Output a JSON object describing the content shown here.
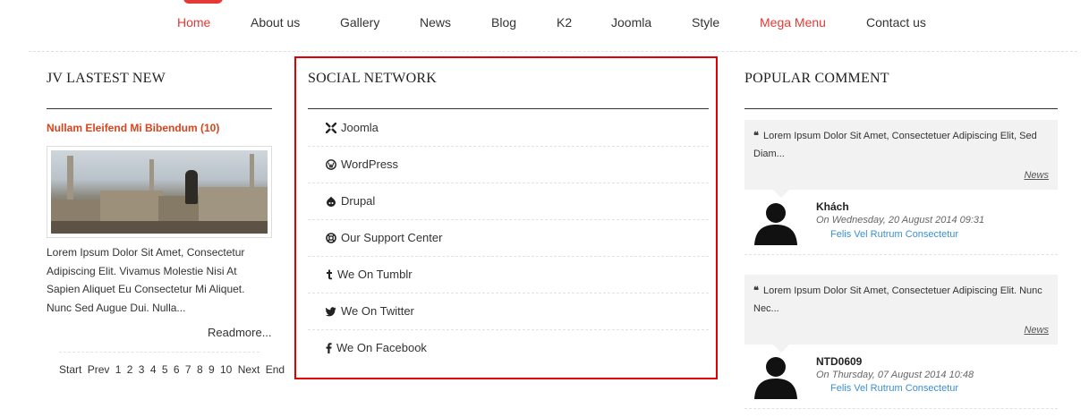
{
  "nav": {
    "items": [
      {
        "label": "Home",
        "active": true
      },
      {
        "label": "About us",
        "active": false
      },
      {
        "label": "Gallery",
        "active": false
      },
      {
        "label": "News",
        "active": false
      },
      {
        "label": "Blog",
        "active": false
      },
      {
        "label": "K2",
        "active": false
      },
      {
        "label": "Joomla",
        "active": false
      },
      {
        "label": "Style",
        "active": false
      },
      {
        "label": "Mega Menu",
        "active": true
      },
      {
        "label": "Contact us",
        "active": false
      }
    ],
    "accent_color": "#e53935"
  },
  "latest": {
    "heading": "JV LASTEST NEW",
    "article_title": "Nullam Eleifend Mi Bibendum (10)",
    "body": "Lorem Ipsum Dolor Sit Amet, Consectetur Adipiscing Elit. Vivamus Molestie Nisi At Sapien Aliquet Eu Consectetur Mi Aliquet. Nunc Sed Augue Dui. Nulla...",
    "readmore": "Readmore...",
    "pager": [
      "Start",
      "Prev",
      "1",
      "2",
      "3",
      "4",
      "5",
      "6",
      "7",
      "8",
      "9",
      "10",
      "Next",
      "End"
    ]
  },
  "social": {
    "heading": "SOCIAL NETWORK",
    "items": [
      {
        "label": "Joomla",
        "icon": "joomla-icon"
      },
      {
        "label": "WordPress",
        "icon": "wordpress-icon"
      },
      {
        "label": "Drupal",
        "icon": "drupal-icon"
      },
      {
        "label": "Our Support Center",
        "icon": "support-icon"
      },
      {
        "label": "We On Tumblr",
        "icon": "tumblr-icon"
      },
      {
        "label": "We On Twitter",
        "icon": "twitter-icon"
      },
      {
        "label": "We On Facebook",
        "icon": "facebook-icon"
      }
    ],
    "highlight_color": "#e00000"
  },
  "popular": {
    "heading": "POPULAR COMMENT",
    "comments": [
      {
        "quote_mark": "❝",
        "text": "Lorem Ipsum Dolor Sit Amet, Consectetuer Adipiscing Elit, Sed Diam...",
        "category": "News",
        "author": "Khách",
        "date": "On Wednesday, 20 August 2014 09:31",
        "link": "Felis Vel Rutrum Consectetur"
      },
      {
        "quote_mark": "❝",
        "text": "Lorem Ipsum Dolor Sit Amet, Consectetuer Adipiscing Elit. Nunc Nec...",
        "category": "News",
        "author": "NTD0609",
        "date": "On Thursday, 07 August 2014 10:48",
        "link": "Felis Vel Rutrum Consectetur"
      }
    ]
  }
}
